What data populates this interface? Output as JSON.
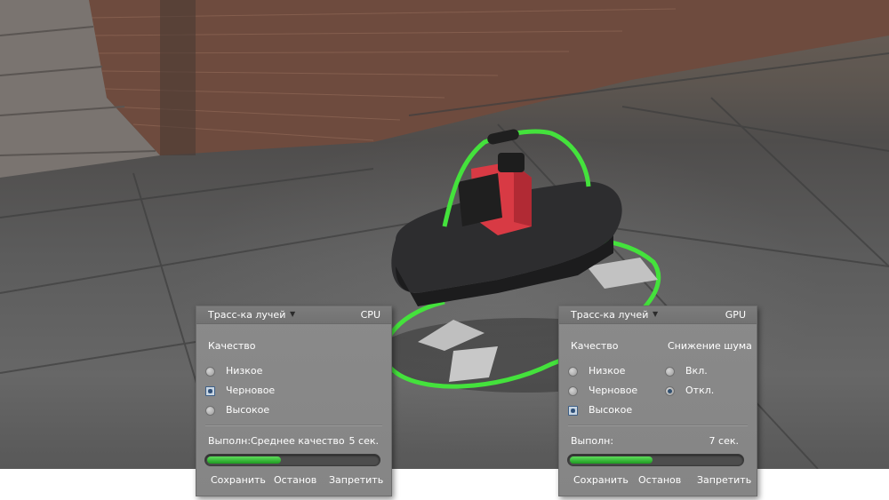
{
  "panels": [
    {
      "mode": "Трасс-ка лучей",
      "device": "CPU",
      "quality_label": "Качество",
      "quality_options": [
        "Низкое",
        "Черновое",
        "Высокое"
      ],
      "quality_selected": "Черновое",
      "status_label": "Выполн:",
      "status_text": "Среднее качество",
      "time": "5 сек.",
      "progress": 0.43,
      "buttons": {
        "save": "Сохранить",
        "stop": "Останов",
        "deny": "Запретить"
      }
    },
    {
      "mode": "Трасс-ка лучей",
      "device": "GPU",
      "quality_label": "Качество",
      "quality_options": [
        "Низкое",
        "Черновое",
        "Высокое"
      ],
      "quality_selected": "Высокое",
      "denoise_label": "Снижение шума",
      "denoise_options": [
        "Вкл.",
        "Откл."
      ],
      "denoise_selected": "Откл.",
      "status_label": "Выполн:",
      "time": "7 сек.",
      "progress": 0.48,
      "buttons": {
        "save": "Сохранить",
        "stop": "Останов",
        "deny": "Запретить"
      }
    }
  ],
  "colors": {
    "panel_bg": "#888888",
    "progress_fill": "#3cc23a",
    "robot_frame": "#44e23c",
    "robot_head": "#d83a44"
  },
  "icons": {
    "mode_dropdown": "triangle-down"
  }
}
